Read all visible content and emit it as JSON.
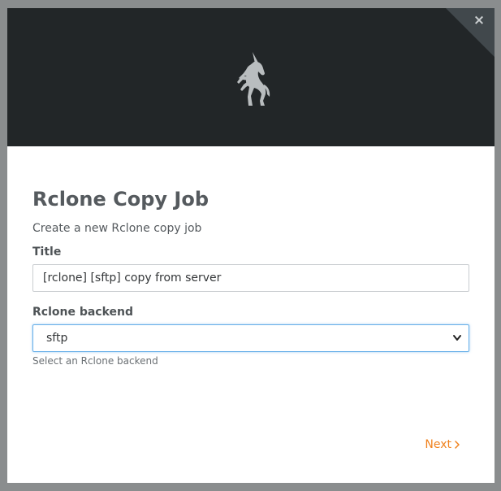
{
  "dialog": {
    "close_label": "×",
    "title": "Rclone Copy Job",
    "subtitle": "Create a new Rclone copy job",
    "title_field": {
      "label": "Title",
      "value": "[rclone] [sftp] copy from server"
    },
    "backend_field": {
      "label": "Rclone backend",
      "selected": "sftp",
      "help": "Select an Rclone backend"
    },
    "next_label": "Next"
  },
  "icons": {
    "logo": "unicorn-icon",
    "close": "close-icon",
    "next": "chevron-right-icon",
    "select": "chevron-down-icon"
  },
  "colors": {
    "header_bg": "#222628",
    "accent": "#f0821e",
    "focus": "#66afe9"
  }
}
